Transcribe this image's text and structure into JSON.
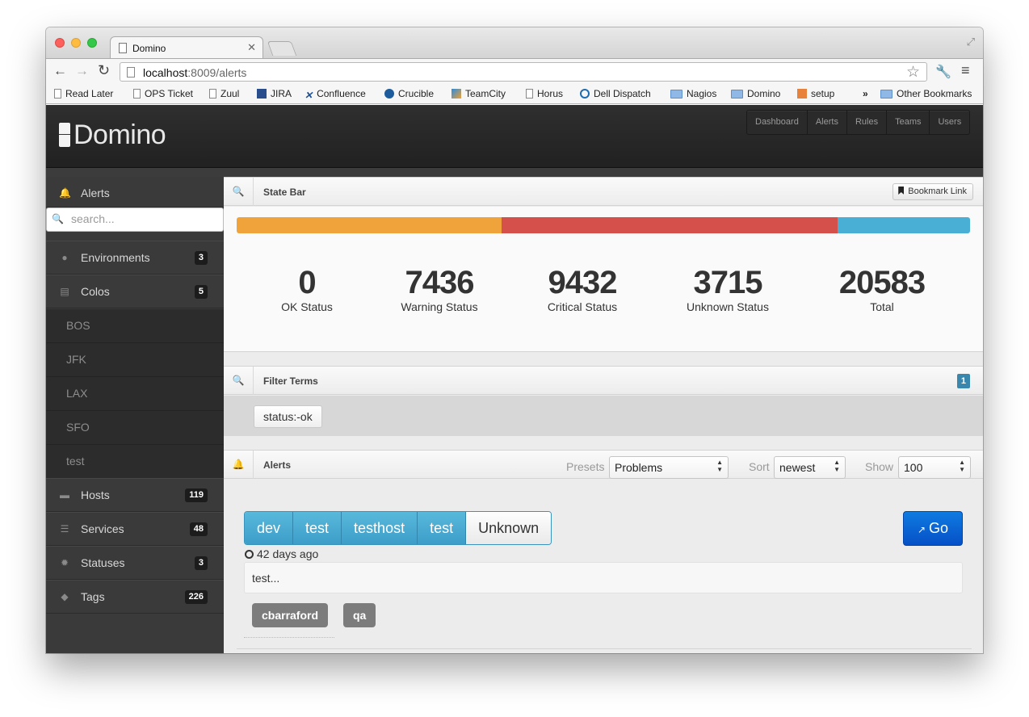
{
  "browser": {
    "tab_title": "Domino",
    "url_host": "localhost",
    "url_path": ":8009/alerts",
    "bookmarks": [
      {
        "label": "Read Later",
        "icon": "doc"
      },
      {
        "label": "OPS Ticket",
        "icon": "doc"
      },
      {
        "label": "Zuul",
        "icon": "doc"
      },
      {
        "label": "JIRA",
        "icon": "jira"
      },
      {
        "label": "Confluence",
        "icon": "conf"
      },
      {
        "label": "Crucible",
        "icon": "cruc"
      },
      {
        "label": "TeamCity",
        "icon": "tc"
      },
      {
        "label": "Horus",
        "icon": "doc"
      },
      {
        "label": "Dell Dispatch",
        "icon": "dell"
      },
      {
        "label": "Nagios",
        "icon": "folder"
      },
      {
        "label": "Domino",
        "icon": "folder"
      },
      {
        "label": "setup",
        "icon": "setup"
      }
    ],
    "overflow_chevron": "»",
    "other_bookmarks": "Other Bookmarks"
  },
  "app": {
    "logo": "Domino",
    "nav": [
      "Dashboard",
      "Alerts",
      "Rules",
      "Teams",
      "Users"
    ]
  },
  "sidebar": {
    "alerts_label": "Alerts",
    "search_placeholder": "search...",
    "items": [
      {
        "label": "Environments",
        "count": "3",
        "icon": "globe-icon"
      },
      {
        "label": "Colos",
        "count": "5",
        "icon": "list-icon"
      }
    ],
    "colos": [
      "BOS",
      "JFK",
      "LAX",
      "SFO",
      "test"
    ],
    "items2": [
      {
        "label": "Hosts",
        "count": "119",
        "icon": "server-icon"
      },
      {
        "label": "Services",
        "count": "48",
        "icon": "list-icon"
      },
      {
        "label": "Statuses",
        "count": "3",
        "icon": "cog-icon"
      },
      {
        "label": "Tags",
        "count": "226",
        "icon": "tags-icon"
      }
    ]
  },
  "state_bar": {
    "title": "State Bar",
    "bookmark_label": "Bookmark Link",
    "segments": [
      {
        "name": "Warning",
        "value": 7436,
        "color": "#f0a33a"
      },
      {
        "name": "Critical",
        "value": 9432,
        "color": "#d6504b"
      },
      {
        "name": "Unknown",
        "value": 3715,
        "color": "#4aafd5"
      }
    ],
    "stats": [
      {
        "value": "0",
        "label": "OK Status"
      },
      {
        "value": "7436",
        "label": "Warning Status"
      },
      {
        "value": "9432",
        "label": "Critical Status"
      },
      {
        "value": "3715",
        "label": "Unknown Status"
      },
      {
        "value": "20583",
        "label": "Total"
      }
    ]
  },
  "filter": {
    "title": "Filter Terms",
    "count": "1",
    "terms": [
      "status:-ok"
    ]
  },
  "alerts": {
    "title": "Alerts",
    "presets_label": "Presets",
    "presets_value": "Problems",
    "sort_label": "Sort",
    "sort_value": "newest",
    "show_label": "Show",
    "show_value": "100",
    "item": {
      "crumbs": [
        "dev",
        "test",
        "testhost",
        "test"
      ],
      "state": "Unknown",
      "go_label": "Go",
      "age": "42 days ago",
      "message": "test...",
      "tags": [
        "cbarraford",
        "qa"
      ]
    }
  }
}
